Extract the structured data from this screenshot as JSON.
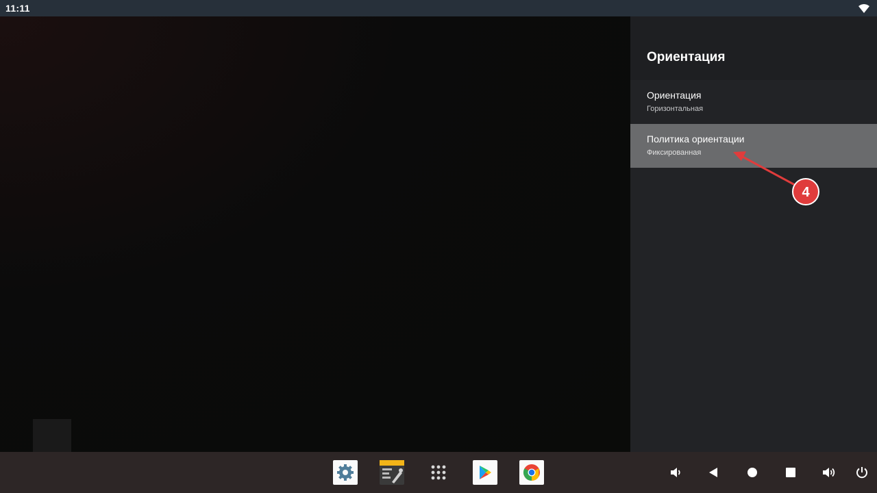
{
  "status_bar": {
    "time": "11:11",
    "wifi_icon": "wifi-icon"
  },
  "panel": {
    "title": "Ориентация",
    "items": [
      {
        "title": "Ориентация",
        "summary": "Горизонтальная",
        "selected": false
      },
      {
        "title": "Политика ориентации",
        "summary": "Фиксированная",
        "selected": true
      }
    ]
  },
  "taskbar": {
    "apps": [
      "settings-icon",
      "file-manager-icon",
      "app-drawer-icon",
      "play-store-icon",
      "chrome-icon"
    ],
    "nav": [
      "volume-down-icon",
      "back-icon",
      "home-icon",
      "recents-icon",
      "volume-up-icon",
      "power-icon"
    ]
  },
  "annotation": {
    "label": "4",
    "color": "#e03c3c"
  },
  "colors": {
    "accent": "#e03c3c",
    "panel": "#222326",
    "selected": "#6a6b6d"
  }
}
